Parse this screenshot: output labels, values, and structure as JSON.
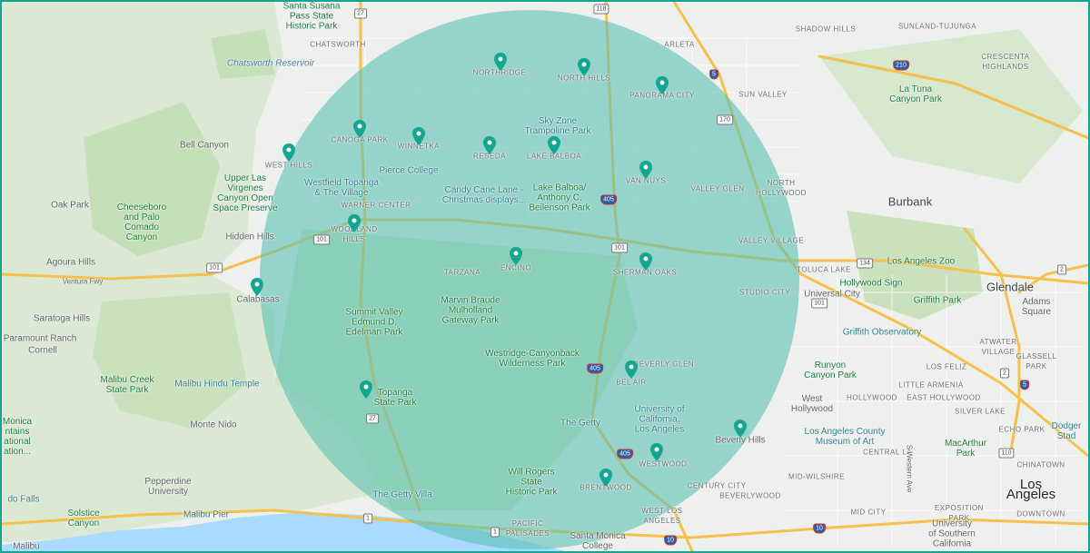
{
  "map": {
    "colors": {
      "land": "#eef0ee",
      "park": "#cfe7c4",
      "water": "#aadaff",
      "radius_fill": "#5cbfb3",
      "marker": "#15a692",
      "frame": "#15a692"
    },
    "labels": {
      "santa_susana": "Santa Susana\nPass State\nHistoric Park",
      "chatsworth": "CHATSWORTH",
      "chatsworth_reservoir": "Chatsworth Reservoir",
      "northridge": "NORTHRIDGE",
      "north_hills": "NORTH HILLS",
      "arleta": "ARLETA",
      "shadow_hills": "SHADOW HILLS",
      "sunland_tujunga": "SUNLAND-TUJUNGA",
      "crescenta_highlands": "CRESCENTA\nHIGHLANDS",
      "panorama_city": "PANORAMA CITY",
      "sun_valley": "SUN VALLEY",
      "la_tuna": "La Tuna\nCanyon Park",
      "sky_zone": "Sky Zone\nTrampoline Park",
      "canoga_park": "CANOGA PARK",
      "winnetka": "WINNETKA",
      "reseda": "RESEDA",
      "lake_balboa": "LAKE BALBOA",
      "bell_canyon": "Bell Canyon",
      "west_hills": "WEST HILLS",
      "pierce_college": "Pierce College",
      "van_nuys": "VAN NUYS",
      "upper_las_virgenes": "Upper Las\nVirgenes\nCanyon Open\nSpace Preserve",
      "westfield_topanga": "Westfield Topanga\n& The Village",
      "candy_cane": "Candy Cane Lane -\nChristmas displays...",
      "valley_glen": "VALLEY GLEN",
      "north_hollywood": "NORTH\nHOLLYWOOD",
      "oak_park": "Oak Park",
      "warner_center": "WARNER CENTER",
      "lake_balboa_park": "Lake Balboa/\nAnthony C.\nBeilenson Park",
      "burbank": "Burbank",
      "cheeseboro": "Cheeseboro\nand Palo\nComado\nCanyon",
      "hidden_hills": "Hidden Hills",
      "woodland_hills": "WOODLAND\nHILLS",
      "valley_village": "VALLEY VILLAGE",
      "agoura_hills": "Agoura Hills",
      "encino": "ENCINO",
      "sherman_oaks": "SHERMAN OAKS",
      "toluca_lake": "TOLUCA LAKE",
      "la_zoo": "Los Angeles Zoo",
      "glendale": "Glendale",
      "ventura_fwy": "Ventura Fwy",
      "tarzana": "TARZANA",
      "hollywood_sign": "Hollywood Sign",
      "calabasas": "Calabasas",
      "studio_city": "STUDIO CITY",
      "universal_city": "Universal City",
      "griffith_park": "Griffith Park",
      "adams_square": "Adams Square",
      "marvin_braude": "Marvin Braude\nMulholland\nGateway Park",
      "saratoga_hills": "Saratoga Hills",
      "summit_valley": "Summit Valley\nEdmund D.\nEdelman Park",
      "griffith_observatory": "Griffith Observatory",
      "paramount_ranch": "Paramount Ranch",
      "cornell": "Cornell",
      "atwater_village": "ATWATER\nVILLAGE",
      "westridge": "Westridge-Canyonback\nWilderness Park",
      "beverly_glen": "BEVERLY GLEN",
      "runyon": "Runyon\nCanyon Park",
      "los_feliz": "LOS FELIZ",
      "glassell_park": "GLASSELL PARK",
      "malibu_creek": "Malibu Creek\nState Park",
      "malibu_hindu": "Malibu Hindu Temple",
      "bel_air": "BEL AIR",
      "little_armenia": "LITTLE ARMENIA",
      "topanga": "Topanga\nState Park",
      "ucla": "University of\nCalifornia,\nLos Angeles",
      "west_hollywood": "West\nHollywood",
      "hollywood": "HOLLYWOOD",
      "east_hollywood": "EAST HOLLYWOOD",
      "silver_lake": "SILVER LAKE",
      "echo_park": "ECHO PARK",
      "dodger_stadium": "Dodger Stad",
      "monica_left": "Monica\nntains\national\nation...",
      "monte_nido": "Monte Nido",
      "the_getty": "The Getty",
      "beverly_hills": "Beverly Hills",
      "lacma": "Los Angeles County\nMuseum of Art",
      "central_la": "CENTRAL LA",
      "macarthur": "MacArthur\nPark",
      "chinatown": "CHINATOWN",
      "westwood": "WESTWOOD",
      "western_ave": "S Western Ave",
      "will_rogers": "Will Rogers\nState\nHistoric Park",
      "pepperdine": "Pepperdine\nUniversity",
      "brentwood": "BRENTWOOD",
      "mid_wilshire": "MID-WILSHIRE",
      "los_angeles": "Los Angeles",
      "century_city": "CENTURY CITY",
      "beverlywood": "BEVERLYWOOD",
      "do_falls": "do Falls",
      "getty_villa": "The Getty Villa",
      "downtown": "DOWNTOWN",
      "solstice": "Solstice\nCanyon",
      "malibu_pier": "Malibu Pier",
      "west_los_angeles": "WEST LOS\nANGELES",
      "mid_city": "MID CITY",
      "exposition_park": "EXPOSITION\nPARK",
      "pacific_palisades": "PACIFIC\nPALISADES",
      "santa_monica_college": "Santa Monica\nCollege",
      "usc": "University\nof Southern\nCalifornia",
      "malibu": "Malibu"
    },
    "shields": [
      "27",
      "118",
      "210",
      "5",
      "170",
      "405",
      "101",
      "134",
      "2",
      "101",
      "101",
      "27",
      "405",
      "101",
      "405",
      "5",
      "2",
      "1",
      "10",
      "1",
      "110",
      "10"
    ],
    "markers": [
      "northridge",
      "north-hills",
      "panorama-city",
      "canoga-park",
      "winnetka",
      "reseda",
      "lake-balboa",
      "west-hills",
      "van-nuys",
      "woodland-hills",
      "encino",
      "sherman-oaks",
      "calabasas",
      "bel-air",
      "topanga",
      "beverly-hills",
      "westwood",
      "brentwood"
    ]
  }
}
